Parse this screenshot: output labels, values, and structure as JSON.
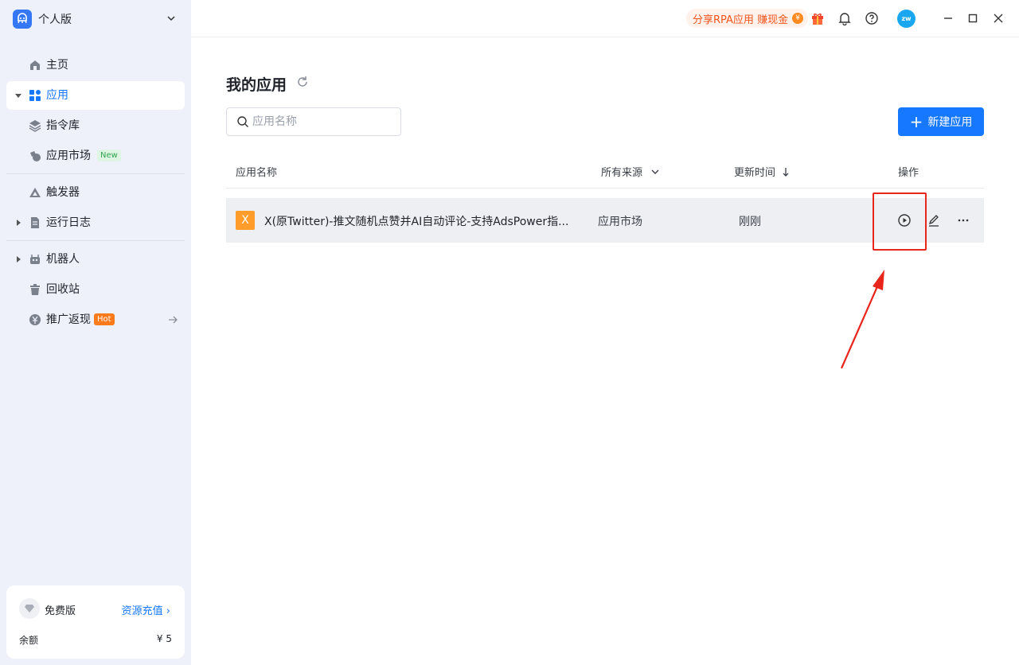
{
  "workspace": {
    "name": "个人版"
  },
  "sidebar": {
    "items": [
      {
        "label": "主页"
      },
      {
        "label": "应用"
      },
      {
        "label": "指令库"
      },
      {
        "label": "应用市场",
        "tag": "New"
      },
      {
        "label": "触发器"
      },
      {
        "label": "运行日志"
      },
      {
        "label": "机器人"
      },
      {
        "label": "回收站"
      },
      {
        "label": "推广返现",
        "tag": "Hot"
      }
    ]
  },
  "plan": {
    "name": "免费版",
    "recharge": "资源充值 ›",
    "balance_label": "余额",
    "balance_value": "¥ 5"
  },
  "topbar": {
    "promo": "分享RPA应用 赚现金",
    "coin": "¥",
    "avatar": "zw"
  },
  "main": {
    "title": "我的应用",
    "search": {
      "placeholder": "应用名称"
    },
    "new_button": "新建应用",
    "columns": {
      "name": "应用名称",
      "source": "所有来源",
      "updated": "更新时间",
      "actions": "操作"
    },
    "rows": [
      {
        "icon_letter": "X",
        "name": "X(原Twitter)-推文随机点赞并AI自动评论-支持AdsPower指...",
        "source": "应用市场",
        "updated": "刚刚"
      }
    ]
  },
  "colors": {
    "accent": "#1677ff",
    "highlight": "#e8261b",
    "promo": "#f2541b",
    "app_icon": "#ff9c2a"
  }
}
